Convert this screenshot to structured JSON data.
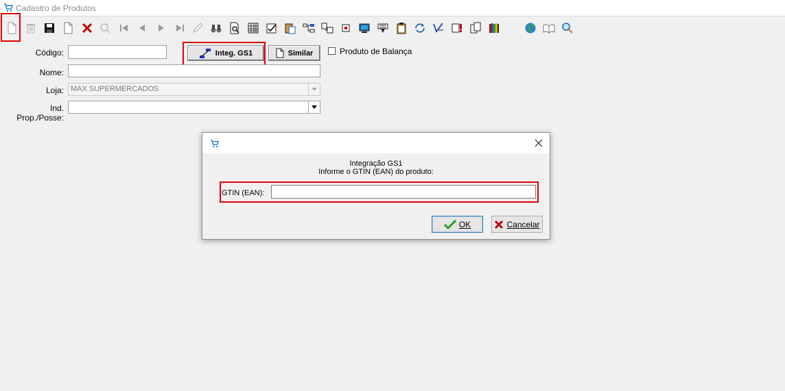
{
  "window": {
    "title": "Cadastro de Produtos",
    "icon": "cart-icon"
  },
  "toolbar": {
    "icons": [
      "new-icon",
      "delete-icon",
      "save-icon",
      "copy-icon",
      "cancel-icon",
      "refresh-icon",
      "first-icon",
      "previous-icon",
      "next-icon",
      "last-icon",
      "pencil-icon",
      "binoculars-icon",
      "search-doc-icon",
      "grid-icon",
      "checklist-icon",
      "paste-icon",
      "hierarchy-icon",
      "transfer-icon",
      "label-icon",
      "monitor-icon",
      "history-icon",
      "clipboard-icon",
      "cycle-icon",
      "validate-icon",
      "alert-icon",
      "multi-copy-icon",
      "books-icon",
      "globe-icon",
      "open-book-icon",
      "magnifier-icon"
    ],
    "highlight_color": "#e00000"
  },
  "form": {
    "codigo_label": "Código:",
    "nome_label": "Nome:",
    "loja_label": "Loja:",
    "loja_value": "MAX SUPERMERCADOS",
    "ind_prop_label": "Ind. Prop./Posse:",
    "integ_button": "Integ. GS1",
    "similar_button": "Similar",
    "balanca_label": "Produto de Balança"
  },
  "dialog": {
    "line1": "Integração GS1",
    "line2": "Informe o GTIN (EAN) do produto:",
    "gtin_label": "GTIN (EAN):",
    "gtin_value": "",
    "ok_button": "OK",
    "cancel_button": "Cancelar"
  }
}
